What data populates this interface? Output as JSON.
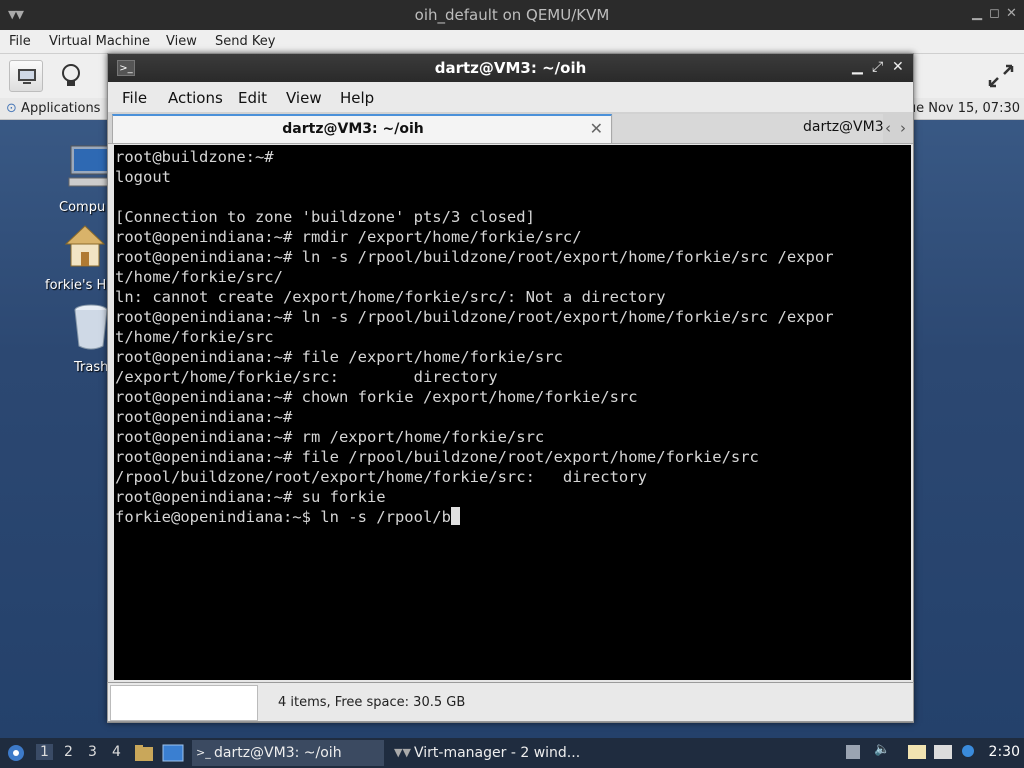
{
  "host": {
    "title": "oih_default on QEMU/KVM",
    "menu": [
      "File",
      "Virtual Machine",
      "View",
      "Send Key"
    ]
  },
  "guest_panel": {
    "applications": "Applications",
    "clock": "ue Nov 15, 07:30"
  },
  "desktop_icons": [
    "Compu",
    "forkie's H",
    "Trash"
  ],
  "terminal": {
    "title": "dartz@VM3: ~/oih",
    "menu": [
      "File",
      "Actions",
      "Edit",
      "View",
      "Help"
    ],
    "tabs": [
      "dartz@VM3: ~/oih",
      "dartz@VM3"
    ],
    "lines": [
      "root@buildzone:~#",
      "logout",
      "",
      "[Connection to zone 'buildzone' pts/3 closed]",
      "root@openindiana:~# rmdir /export/home/forkie/src/",
      "root@openindiana:~# ln -s /rpool/buildzone/root/export/home/forkie/src /expor",
      "t/home/forkie/src/",
      "ln: cannot create /export/home/forkie/src/: Not a directory",
      "root@openindiana:~# ln -s /rpool/buildzone/root/export/home/forkie/src /expor",
      "t/home/forkie/src",
      "root@openindiana:~# file /export/home/forkie/src",
      "/export/home/forkie/src:        directory",
      "root@openindiana:~# chown forkie /export/home/forkie/src",
      "root@openindiana:~#",
      "root@openindiana:~# rm /export/home/forkie/src",
      "root@openindiana:~# file /rpool/buildzone/root/export/home/forkie/src",
      "/rpool/buildzone/root/export/home/forkie/src:   directory",
      "root@openindiana:~# su forkie"
    ],
    "prompt_line": "forkie@openindiana:~$ ln -s /rpool/b"
  },
  "file_manager_status": "4 items, Free space: 30.5 GB",
  "taskbar": {
    "workspaces": [
      "1",
      "2",
      "3",
      "4"
    ],
    "tasks": [
      "dartz@VM3: ~/oih",
      "Virt-manager - 2 wind..."
    ],
    "clock": "2:30"
  },
  "colors": {
    "terminal_bg": "#000000",
    "terminal_fg": "#d6d6d6",
    "desktop_bg": "#2c4872",
    "taskbar_bg": "#1f2c3f"
  }
}
